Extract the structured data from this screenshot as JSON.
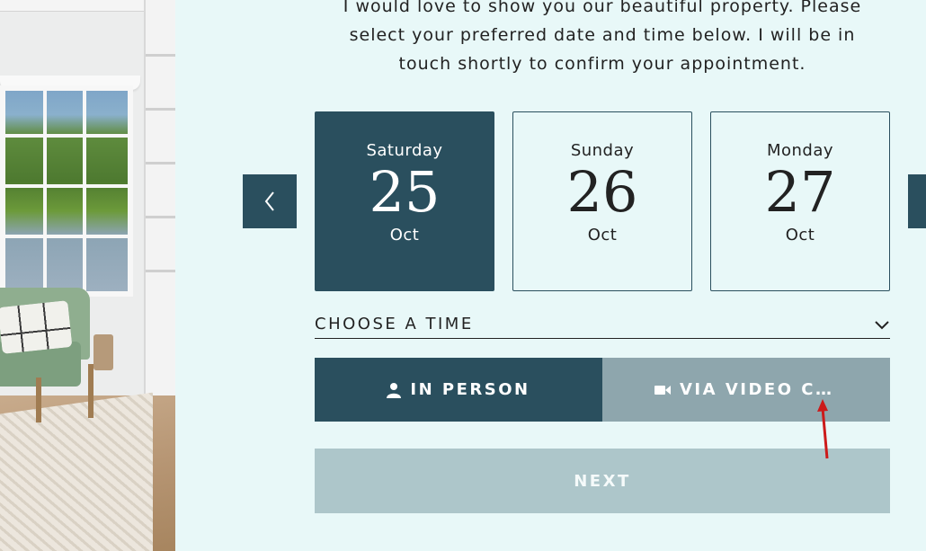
{
  "intro": {
    "line1": "I would love to show you our beautiful property. Please",
    "line2": "select your preferred date and time below. I will be in",
    "line3": "touch shortly to confirm your appointment."
  },
  "dates": [
    {
      "weekday": "Saturday",
      "day": "25",
      "month": "Oct",
      "selected": true
    },
    {
      "weekday": "Sunday",
      "day": "26",
      "month": "Oct",
      "selected": false
    },
    {
      "weekday": "Monday",
      "day": "27",
      "month": "Oct",
      "selected": false
    }
  ],
  "nav": {
    "prev_icon": "chevron-left-icon",
    "next_icon": "chevron-right-icon"
  },
  "time": {
    "label": "CHOOSE A TIME",
    "icon": "chevron-down-icon"
  },
  "meeting_type": {
    "in_person_label": "IN PERSON",
    "in_person_icon": "person-icon",
    "video_label": "VIA VIDEO CH…",
    "video_icon": "video-camera-icon",
    "selected": "in_person"
  },
  "next_button": {
    "label": "NEXT"
  },
  "colors": {
    "background": "#e8f8f8",
    "primary": "#2a4f5e",
    "muted": "#8ea6ad",
    "next_disabled": "#adc6ca",
    "annotation": "#cc1a1a"
  }
}
